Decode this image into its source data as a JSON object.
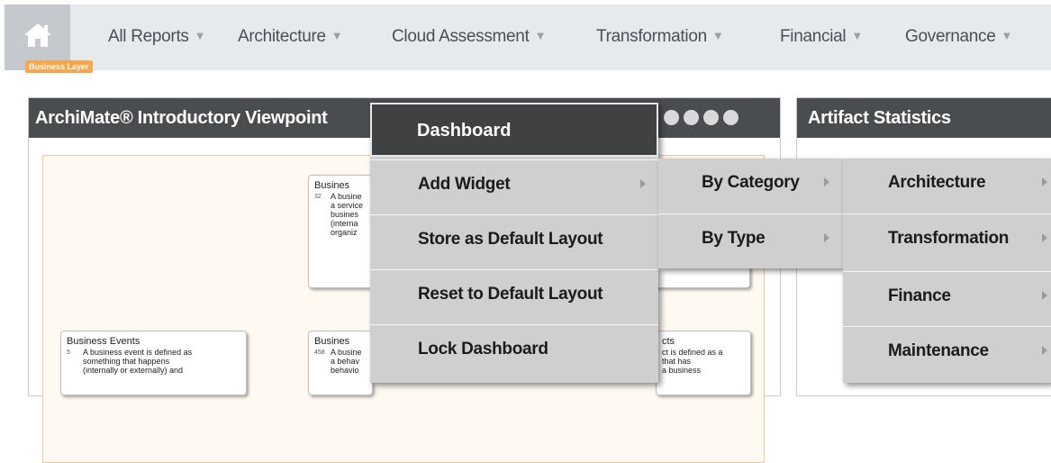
{
  "nav": {
    "items": [
      {
        "label": "All Reports"
      },
      {
        "label": "Architecture"
      },
      {
        "label": "Cloud Assessment"
      },
      {
        "label": "Transformation"
      },
      {
        "label": "Financial"
      },
      {
        "label": "Governance"
      }
    ],
    "caret": "▼"
  },
  "panel_left": {
    "title": "ArchiMate® Introductory Viewpoint",
    "layer_tag": "Business Layer",
    "cards": [
      {
        "title": "Busines",
        "count": "32",
        "desc": "A busine\na service\nbusines\n(interna\norganiz"
      },
      {
        "title": "Business Events",
        "count": "5",
        "desc": "A business event is defined as\nsomething that happens\n(internally or externally) and"
      },
      {
        "title": "Busines",
        "count": "458",
        "desc": "A busine\na behav\nbehavio"
      },
      {
        "title": "cts",
        "count": "",
        "desc": "ct is defined as a\nthat has\na business"
      }
    ]
  },
  "panel_right": {
    "title": "Artifact Statistics"
  },
  "menu_dashboard": {
    "header": "Dashboard",
    "items": [
      {
        "label": "Add Widget"
      },
      {
        "label": "Store as Default Layout"
      },
      {
        "label": "Reset to Default Layout"
      },
      {
        "label": "Lock Dashboard"
      }
    ]
  },
  "menu_addwidget": {
    "items": [
      {
        "label": "By Category"
      },
      {
        "label": "By Type"
      }
    ]
  },
  "menu_category": {
    "items": [
      {
        "label": "Architecture"
      },
      {
        "label": "Transformation"
      },
      {
        "label": "Finance"
      },
      {
        "label": "Maintenance"
      }
    ]
  },
  "colors": {
    "nav_bg": "#e7eaed",
    "home_bg": "#c5c9cd",
    "panel_header": "#4a4d50",
    "menu_item_bg": "#cfcfcf",
    "menu_header_bg": "#3f4143",
    "layer_tag": "#f7a64a"
  },
  "icons": {
    "home": "home-icon",
    "print": "print-icon",
    "collapse": "collapse-icon",
    "disable": "disable-icon",
    "close": "close-icon"
  }
}
